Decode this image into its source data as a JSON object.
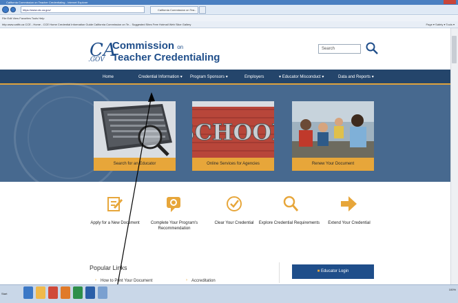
{
  "browser": {
    "title": "California Commission on Teacher Credentialing - Internet Explorer",
    "address": "https://www.ctc.ca.gov/",
    "tab_title": "California Commission on Tea...",
    "menu": "File   Edit   View   Favorites   Tools   Help",
    "favorites": "http  www.cattfx.ca   CCE - Home - CCE Home   Credential Information Guide   California Commission on Te...   Suggested Sites   Free Hotmail   Web Slice Gallery",
    "favorites_right": "Page ▾   Safety ▾   Tools ▾",
    "tray_text": "100%"
  },
  "header": {
    "logo_mark": "CA",
    "logo_gov": ".GOV",
    "title_line1": "Commission",
    "title_on": "on",
    "title_line2": "Teacher Credentialing",
    "search_placeholder": "Search"
  },
  "nav": {
    "items": [
      "Home",
      "Credential Information",
      "Program Sponsors",
      "Employers",
      "Educator Misconduct",
      "Data and Reports"
    ]
  },
  "hero": {
    "cards": [
      {
        "button": "Search for an Educator"
      },
      {
        "button": "Online Services for Agencies",
        "sign": "SCHOOL"
      },
      {
        "button": "Renew Your Document"
      }
    ]
  },
  "quick_links": [
    {
      "label": "Apply for a New Document",
      "icon": "edit-document-icon"
    },
    {
      "label": "Complete Your Program's Recommendation",
      "icon": "chat-icon"
    },
    {
      "label": "Clear Your Credential",
      "icon": "check-circle-icon"
    },
    {
      "label": "Explore Credential Requirements",
      "icon": "search-icon"
    },
    {
      "label": "Extend Your Credential",
      "icon": "arrow-right-icon"
    }
  ],
  "popular": {
    "title": "Popular Links",
    "links": [
      "How to Print Your Document",
      "Accreditation"
    ]
  },
  "educator_login": "Educator Login",
  "colors": {
    "brand": "#1f4e8a",
    "nav": "#24456b",
    "accent": "#e7a63a",
    "hero": "#47698f"
  }
}
